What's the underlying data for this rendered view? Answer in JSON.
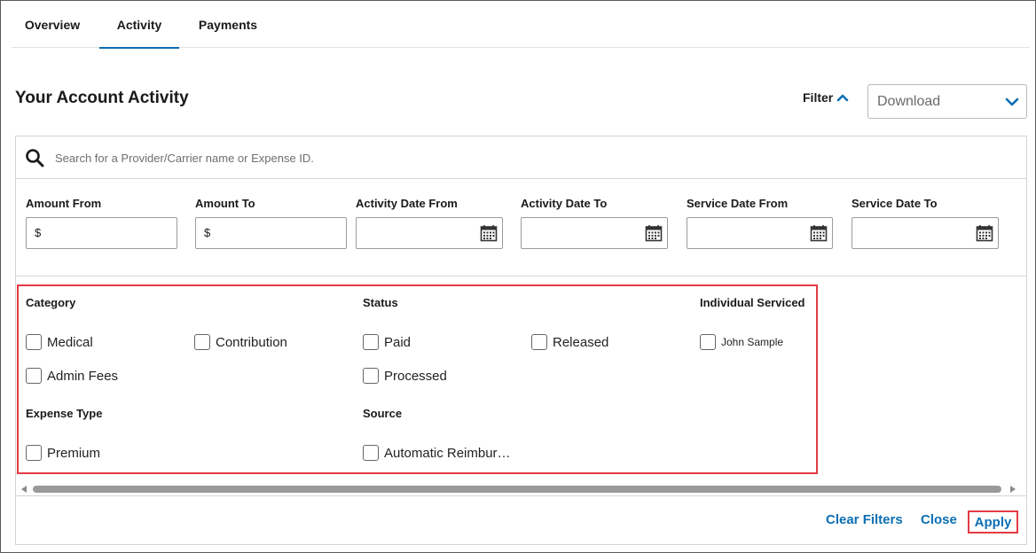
{
  "tabs": [
    {
      "label": "Overview",
      "active": false
    },
    {
      "label": "Activity",
      "active": true
    },
    {
      "label": "Payments",
      "active": false
    }
  ],
  "page_title": "Your Account Activity",
  "filter_toggle": {
    "label": "Filter",
    "icon": "chevron-up-icon",
    "expanded": true
  },
  "download": {
    "selected": "Download",
    "icon": "chevron-down-icon"
  },
  "search": {
    "placeholder": "Search for a Provider/Carrier name or Expense ID.",
    "value": "",
    "icon": "search-icon"
  },
  "fields": [
    {
      "label": "Amount From",
      "prefix": "$",
      "type": "amount"
    },
    {
      "label": "Amount To",
      "prefix": "$",
      "type": "amount"
    },
    {
      "label": "Activity Date From",
      "type": "date"
    },
    {
      "label": "Activity Date To",
      "type": "date"
    },
    {
      "label": "Service Date From",
      "type": "date"
    },
    {
      "label": "Service Date To",
      "type": "date"
    }
  ],
  "category": {
    "title": "Category",
    "options": [
      "Medical",
      "Contribution",
      "Admin Fees"
    ]
  },
  "status": {
    "title": "Status",
    "options": [
      "Paid",
      "Released",
      "Processed"
    ]
  },
  "individual": {
    "title": "Individual Serviced",
    "options": [
      "John Sample"
    ]
  },
  "expense_type": {
    "title": "Expense Type",
    "options": [
      "Premium"
    ]
  },
  "source": {
    "title": "Source",
    "options": [
      "Automatic Reimbur…"
    ]
  },
  "actions": {
    "clear": "Clear Filters",
    "close": "Close",
    "apply": "Apply"
  },
  "colors": {
    "accent": "#0b6fb3",
    "highlight": "#e23b44",
    "border": "#d4d4d4"
  }
}
